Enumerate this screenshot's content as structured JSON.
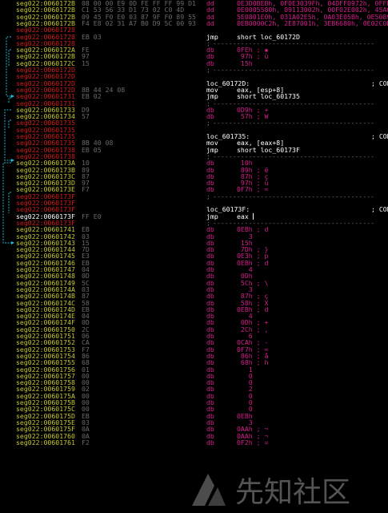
{
  "watermark": {
    "text": "先知社区"
  },
  "rows": [
    {
      "addr": "seg022:0060172B",
      "seg": "y",
      "hex": "08 00 00 E9 0D FE FF FF 99 D1",
      "ins": "dd",
      "opnd": "0E3D0BEBh, 0F0E3039Fh, 04DFF0972h, 0FFFFE4",
      "ic": "db"
    },
    {
      "addr": "seg022:0060172B",
      "seg": "y",
      "hex": "C1 53 56 33 D1 73 02 C0 4D",
      "ins": "dd",
      "opnd": "0E0005580h, 09113002h, 00F02E002h, 45A09C",
      "ic": "db"
    },
    {
      "addr": "seg022:0060172B",
      "seg": "y",
      "hex": "09 45 F0 E0 03 87 9F F0 89 55",
      "ins": "dd",
      "opnd": "5E0801E0h, 031A02E5h, 0A03E05Bh, 0E5089E9",
      "ic": "db"
    },
    {
      "addr": "seg022:0060172B",
      "seg": "y",
      "hex": "F4 E8 02 31 A7 B0 D9 5C 00 93",
      "ins": "dd",
      "opnd": "0EB0000C2h, 2E87001h, 3EB6680h, 0E02C0E35",
      "ic": "db"
    },
    {
      "addr": "seg022:00601728",
      "seg": "r",
      "hex": "",
      "ins": "",
      "opnd": "",
      "ic": ""
    },
    {
      "addr": "seg022:00601728",
      "seg": "r",
      "hex": "EB 03",
      "ins": "jmp",
      "opnd": "short loc_60172D",
      "ic": "ins"
    },
    {
      "addr": "seg022:00601728",
      "seg": "r",
      "hex": "",
      "ins": ";",
      "opnd": "-----------------------------------------",
      "ic": "sep"
    },
    {
      "addr": "seg022:0060172A",
      "seg": "y",
      "hex": "FE",
      "ins": "db",
      "opnd": "0FEh ; ▪",
      "ic": "db"
    },
    {
      "addr": "seg022:0060172B",
      "seg": "y",
      "hex": "97",
      "ins": "db",
      "opnd": " 97h ; ù",
      "ic": "db"
    },
    {
      "addr": "seg022:0060172C",
      "seg": "y",
      "hex": "15",
      "ins": "db",
      "opnd": " 15h",
      "ic": "db"
    },
    {
      "addr": "seg022:0060172D",
      "seg": "r",
      "hex": "",
      "ins": ";",
      "opnd": "-----------------------------------------",
      "ic": "sep"
    },
    {
      "addr": "seg022:0060172D",
      "seg": "r",
      "hex": "",
      "ins": "",
      "opnd": "",
      "ic": ""
    },
    {
      "addr": "seg022:0060172D",
      "seg": "r",
      "hex": "",
      "ins": "loc_60172D:",
      "opnd": "",
      "ic": "lbl",
      "cmt": "; COD"
    },
    {
      "addr": "seg022:0060172D",
      "seg": "r",
      "hex": "8B 44 24 08",
      "ins": "mov",
      "opnd": "eax, [esp+8]",
      "ic": "ins"
    },
    {
      "addr": "seg022:00601731",
      "seg": "r",
      "hex": "EB 02",
      "ins": "jmp",
      "opnd": "short loc_601735",
      "ic": "ins"
    },
    {
      "addr": "seg022:00601731",
      "seg": "r",
      "hex": "",
      "ins": ";",
      "opnd": "-----------------------------------------",
      "ic": "sep"
    },
    {
      "addr": "seg022:00601733",
      "seg": "y",
      "hex": "D9",
      "ins": "db",
      "opnd": "0D9h ; +",
      "ic": "db"
    },
    {
      "addr": "seg022:00601734",
      "seg": "y",
      "hex": "57",
      "ins": "db",
      "opnd": " 57h ; W",
      "ic": "db"
    },
    {
      "addr": "seg022:00601735",
      "seg": "r",
      "hex": "",
      "ins": ";",
      "opnd": "-----------------------------------------",
      "ic": "sep"
    },
    {
      "addr": "seg022:00601735",
      "seg": "r",
      "hex": "",
      "ins": "",
      "opnd": "",
      "ic": ""
    },
    {
      "addr": "seg022:00601735",
      "seg": "r",
      "hex": "",
      "ins": "loc_601735:",
      "opnd": "",
      "ic": "lbl",
      "cmt": "; COD"
    },
    {
      "addr": "seg022:00601735",
      "seg": "r",
      "hex": "8B 40 08",
      "ins": "mov",
      "opnd": "eax, [eax+8]",
      "ic": "ins"
    },
    {
      "addr": "seg022:00601738",
      "seg": "r",
      "hex": "EB 05",
      "ins": "jmp",
      "opnd": "short loc_60173F",
      "ic": "ins"
    },
    {
      "addr": "seg022:00601738",
      "seg": "r",
      "hex": "",
      "ins": ";",
      "opnd": "-----------------------------------------",
      "ic": "sep"
    },
    {
      "addr": "seg022:0060173A",
      "seg": "y",
      "hex": "10",
      "ins": "db",
      "opnd": " 10h",
      "ic": "db"
    },
    {
      "addr": "seg022:0060173B",
      "seg": "y",
      "hex": "89",
      "ins": "db",
      "opnd": " 89h ; ë",
      "ic": "db"
    },
    {
      "addr": "seg022:0060173C",
      "seg": "y",
      "hex": "87",
      "ins": "db",
      "opnd": " 87h ; ç",
      "ic": "db"
    },
    {
      "addr": "seg022:0060173D",
      "seg": "y",
      "hex": "97",
      "ins": "db",
      "opnd": " 97h ; ù",
      "ic": "db"
    },
    {
      "addr": "seg022:0060173E",
      "seg": "y",
      "hex": "F7",
      "ins": "db",
      "opnd": "0F7h ; ≈",
      "ic": "db"
    },
    {
      "addr": "seg022:0060173F",
      "seg": "r",
      "hex": "",
      "ins": ";",
      "opnd": "-----------------------------------------",
      "ic": "sep"
    },
    {
      "addr": "seg022:0060173F",
      "seg": "r",
      "hex": "",
      "ins": "",
      "opnd": "",
      "ic": ""
    },
    {
      "addr": "seg022:0060173F",
      "seg": "r",
      "hex": "",
      "ins": "loc_60173F:",
      "opnd": "",
      "ic": "lbl",
      "cmt": "; COD"
    },
    {
      "addr": "seg022:0060173F",
      "seg": "w",
      "hex": "FF E0",
      "ins": "jmp",
      "opnd": "eax",
      "ic": "ins",
      "cursor": true
    },
    {
      "addr": "seg022:0060173F",
      "seg": "r",
      "hex": "",
      "ins": ";",
      "opnd": "-----------------------------------------",
      "ic": "sep"
    },
    {
      "addr": "seg022:00601741",
      "seg": "y",
      "hex": "EB",
      "ins": "db",
      "opnd": "0EBh ; d",
      "ic": "db"
    },
    {
      "addr": "seg022:00601742",
      "seg": "y",
      "hex": "03",
      "ins": "db",
      "opnd": "   3",
      "ic": "db"
    },
    {
      "addr": "seg022:00601743",
      "seg": "y",
      "hex": "15",
      "ins": "db",
      "opnd": " 15h",
      "ic": "db"
    },
    {
      "addr": "seg022:00601744",
      "seg": "y",
      "hex": "7D",
      "ins": "db",
      "opnd": " 7Dh ; }",
      "ic": "db"
    },
    {
      "addr": "seg022:00601745",
      "seg": "y",
      "hex": "E3",
      "ins": "db",
      "opnd": "0E3h ; p",
      "ic": "db"
    },
    {
      "addr": "seg022:00601746",
      "seg": "y",
      "hex": "EB",
      "ins": "db",
      "opnd": "0EBh ; d",
      "ic": "db"
    },
    {
      "addr": "seg022:00601747",
      "seg": "y",
      "hex": "04",
      "ins": "db",
      "opnd": "   4",
      "ic": "db"
    },
    {
      "addr": "seg022:00601748",
      "seg": "y",
      "hex": "0D",
      "ins": "db",
      "opnd": " 0Dh",
      "ic": "db"
    },
    {
      "addr": "seg022:00601749",
      "seg": "y",
      "hex": "5C",
      "ins": "db",
      "opnd": " 5Ch ; \\",
      "ic": "db"
    },
    {
      "addr": "seg022:0060174A",
      "seg": "y",
      "hex": "03",
      "ins": "db",
      "opnd": "   3",
      "ic": "db"
    },
    {
      "addr": "seg022:0060174B",
      "seg": "y",
      "hex": "87",
      "ins": "db",
      "opnd": " 87h ; ç",
      "ic": "db"
    },
    {
      "addr": "seg022:0060174C",
      "seg": "y",
      "hex": "58",
      "ins": "db",
      "opnd": " 58h ; X",
      "ic": "db"
    },
    {
      "addr": "seg022:0060174D",
      "seg": "y",
      "hex": "EB",
      "ins": "db",
      "opnd": "0EBh ; d",
      "ic": "db"
    },
    {
      "addr": "seg022:0060174E",
      "seg": "y",
      "hex": "04",
      "ins": "db",
      "opnd": "   4",
      "ic": "db"
    },
    {
      "addr": "seg022:0060174F",
      "seg": "y",
      "hex": "0D",
      "ins": "db",
      "opnd": " 0Dh ; +",
      "ic": "db"
    },
    {
      "addr": "seg022:00601750",
      "seg": "y",
      "hex": "2C",
      "ins": "db",
      "opnd": " 2Ch ; ,",
      "ic": "db"
    },
    {
      "addr": "seg022:00601751",
      "seg": "y",
      "hex": "06",
      "ins": "db",
      "opnd": "   6",
      "ic": "db"
    },
    {
      "addr": "seg022:00601752",
      "seg": "y",
      "hex": "CA",
      "ins": "db",
      "opnd": "0CAh ; -",
      "ic": "db"
    },
    {
      "addr": "seg022:00601753",
      "seg": "y",
      "hex": "F7",
      "ins": "db",
      "opnd": "0F7h ; ≈",
      "ic": "db"
    },
    {
      "addr": "seg022:00601754",
      "seg": "y",
      "hex": "86",
      "ins": "db",
      "opnd": " 86h ; å",
      "ic": "db"
    },
    {
      "addr": "seg022:00601755",
      "seg": "y",
      "hex": "68",
      "ins": "db",
      "opnd": " 68h ; h",
      "ic": "db"
    },
    {
      "addr": "seg022:00601756",
      "seg": "y",
      "hex": "01",
      "ins": "db",
      "opnd": "   1",
      "ic": "db"
    },
    {
      "addr": "seg022:00601757",
      "seg": "y",
      "hex": "00",
      "ins": "db",
      "opnd": "   0",
      "ic": "db"
    },
    {
      "addr": "seg022:00601758",
      "seg": "y",
      "hex": "00",
      "ins": "db",
      "opnd": "   0",
      "ic": "db"
    },
    {
      "addr": "seg022:00601759",
      "seg": "y",
      "hex": "02",
      "ins": "db",
      "opnd": "   2",
      "ic": "db"
    },
    {
      "addr": "seg022:0060175A",
      "seg": "y",
      "hex": "00",
      "ins": "db",
      "opnd": "   0",
      "ic": "db"
    },
    {
      "addr": "seg022:0060175B",
      "seg": "y",
      "hex": "00",
      "ins": "db",
      "opnd": "   0",
      "ic": "db"
    },
    {
      "addr": "seg022:0060175C",
      "seg": "y",
      "hex": "00",
      "ins": "db",
      "opnd": "   0",
      "ic": "db"
    },
    {
      "addr": "seg022:0060175D",
      "seg": "y",
      "hex": "EB",
      "ins": "db",
      "opnd": "0EBh",
      "ic": "db"
    },
    {
      "addr": "seg022:0060175E",
      "seg": "y",
      "hex": "03",
      "ins": "db",
      "opnd": "   3",
      "ic": "db"
    },
    {
      "addr": "seg022:0060175F",
      "seg": "y",
      "hex": "0A",
      "ins": "db",
      "opnd": "0AAh ; ¬",
      "ic": "db"
    },
    {
      "addr": "seg022:00601760",
      "seg": "y",
      "hex": "0A",
      "ins": "db",
      "opnd": "0AAh ; ¬",
      "ic": "db"
    },
    {
      "addr": "seg022:00601761",
      "seg": "y",
      "hex": "F2",
      "ins": "db",
      "opnd": "0F2h ; =",
      "ic": "db"
    }
  ]
}
